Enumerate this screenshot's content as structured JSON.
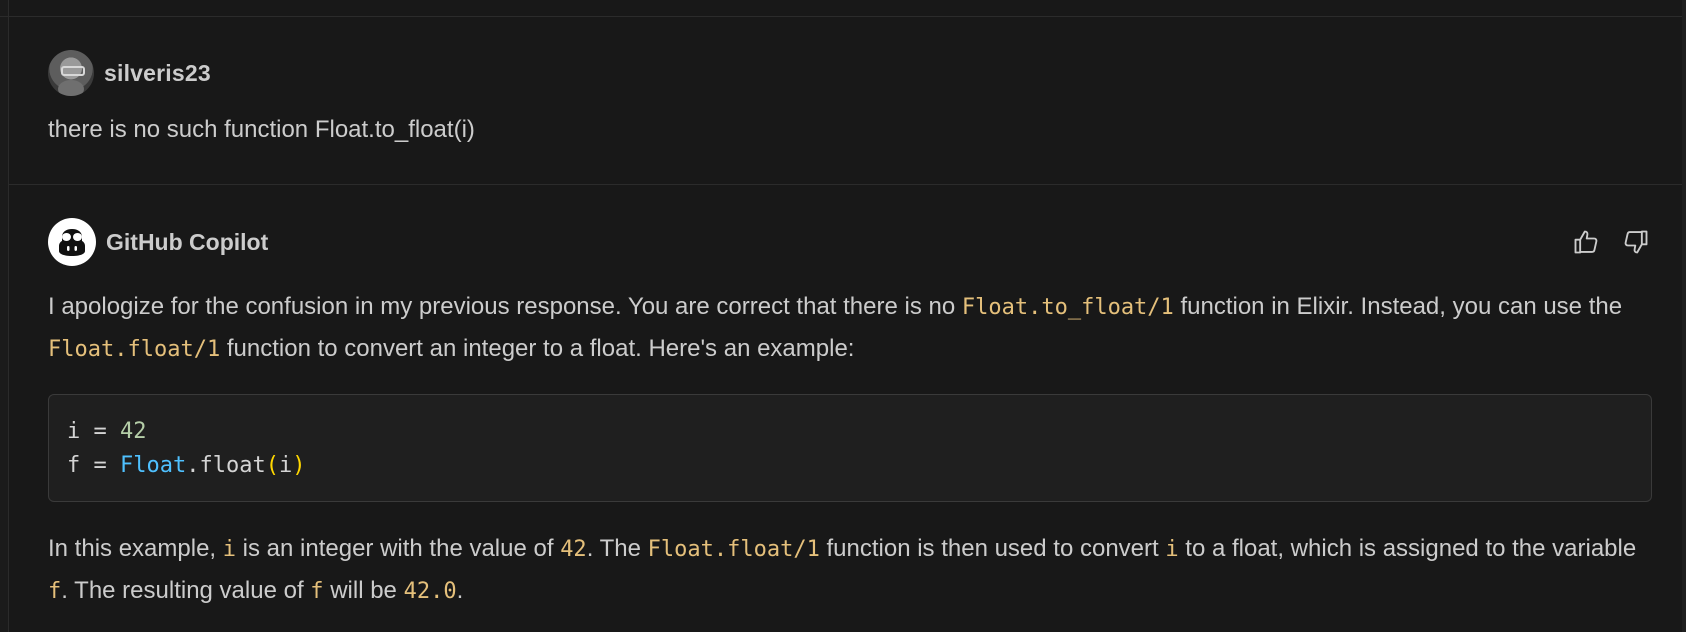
{
  "user_message": {
    "username": "silveris23",
    "text": "there is no such function Float.to_float(i)"
  },
  "bot_message": {
    "name": "GitHub Copilot",
    "p1": {
      "t1": "I apologize for the confusion in my previous response. You are correct that there is no ",
      "c1": "Float.to_float/1",
      "t2": " function in Elixir. Instead, you can use the ",
      "c2": "Float.float/1",
      "t3": " function to convert an integer to a float. Here's an example:"
    },
    "code": {
      "line1_var": "i",
      "line1_eq": " = ",
      "line1_num": "42",
      "line2_var": "f",
      "line2_eq": " = ",
      "line2_mod": "Float",
      "line2_dot_fn": ".float",
      "line2_open": "(",
      "line2_arg": "i",
      "line2_close": ")"
    },
    "p2": {
      "t1": "In this example, ",
      "c1": "i",
      "t2": " is an integer with the value of ",
      "c2": "42",
      "t3": ". The ",
      "c3": "Float.float/1",
      "t4": " function is then used to convert ",
      "c4": "i",
      "t5": " to a float, which is assigned to the variable ",
      "c5": "f",
      "t6": ". The resulting value of ",
      "c6": "f",
      "t7": " will be ",
      "c7": "42.0",
      "t8": "."
    }
  },
  "icons": {
    "user_avatar": "avatar-icon",
    "copilot": "copilot-icon",
    "thumbs_up": "thumbs-up-icon",
    "thumbs_down": "thumbs-down-icon"
  },
  "colors": {
    "background": "#181818",
    "text": "#cccccc",
    "inline_code": "#e5c07b",
    "code_number": "#b5cea8",
    "code_module": "#4fc1ff",
    "code_paren": "#ffd700"
  }
}
